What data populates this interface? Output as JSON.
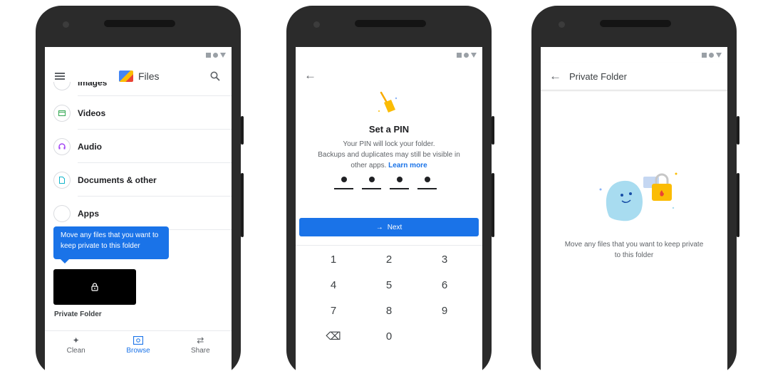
{
  "phone1": {
    "app_title": "Files",
    "list_items": [
      {
        "label": "Images",
        "icon": "image-icon",
        "color": "#ea4335"
      },
      {
        "label": "Videos",
        "icon": "video-icon",
        "color": "#34a853"
      },
      {
        "label": "Audio",
        "icon": "headphones-icon",
        "color": "#a142f4"
      },
      {
        "label": "Documents & other",
        "icon": "document-icon",
        "color": "#12b5cb"
      },
      {
        "label": "Apps",
        "icon": "apps-icon",
        "color": "#5f6368"
      }
    ],
    "tooltip": "Move any files that you want to keep private to this folder",
    "private_folder_label": "Private Folder",
    "nav": [
      {
        "label": "Clean",
        "icon": "sparkle-icon",
        "active": false
      },
      {
        "label": "Browse",
        "icon": "browse-icon",
        "active": true
      },
      {
        "label": "Share",
        "icon": "swap-icon",
        "active": false
      }
    ]
  },
  "phone2": {
    "title": "Set a PIN",
    "description_lines": [
      "Your PIN will lock your folder.",
      "Backups and duplicates may still be visible in",
      "other apps."
    ],
    "learn_more": "Learn more",
    "next_label": "Next",
    "keys": [
      "1",
      "2",
      "3",
      "4",
      "5",
      "6",
      "7",
      "8",
      "9",
      "⌫",
      "0",
      ""
    ]
  },
  "phone3": {
    "title": "Private Folder",
    "message": "Move any files that you want to keep private to this folder"
  },
  "colors": {
    "accent": "#1a73e8",
    "phone_body": "#2b2b2b"
  }
}
